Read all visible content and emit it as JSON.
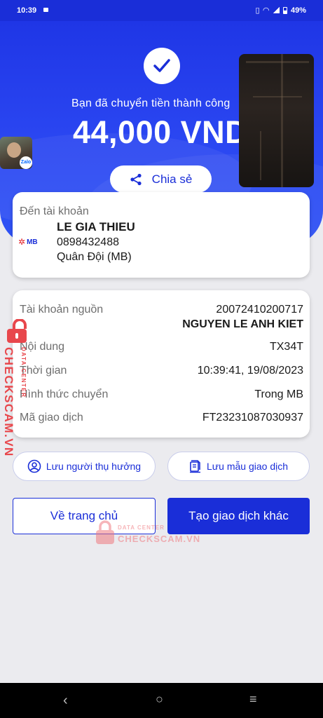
{
  "status_bar": {
    "time": "10:39",
    "battery": "49%"
  },
  "hero": {
    "success_text": "Bạn đã chuyển tiền thành công",
    "amount": "44,000 VND",
    "share_label": "Chia sẻ",
    "avatar_badge": "Zalo"
  },
  "recipient": {
    "label": "Đến tài khoản",
    "bank_logo": "MB",
    "name": "LE GIA THIEU",
    "account": "0898432488",
    "bank": "Quân Đội (MB)"
  },
  "details": {
    "source_label": "Tài khoản nguồn",
    "source_account": "20072410200717",
    "source_name": "NGUYEN LE ANH KIET",
    "content_label": "Nội dung",
    "content_value": "TX34T",
    "time_label": "Thời gian",
    "time_value": "10:39:41, 19/08/2023",
    "method_label": "Hình thức chuyển",
    "method_value": "Trong MB",
    "txn_label": "Mã giao dịch",
    "txn_value": "FT23231087030937"
  },
  "actions": {
    "save_beneficiary": "Lưu người thụ hưởng",
    "save_template": "Lưu mẫu giao dịch",
    "home": "Về trang chủ",
    "new_transaction": "Tạo giao dịch khác"
  },
  "watermark": {
    "brand": "CHECKSCAM.VN",
    "sub": "DATA CENTER"
  },
  "icons": {
    "check": "check-icon",
    "share": "share-icon",
    "user": "user-circle-icon",
    "template": "document-icon"
  },
  "colors": {
    "primary": "#1a2ed8",
    "hero": "#2b47f2",
    "watermark": "#e8474c"
  }
}
